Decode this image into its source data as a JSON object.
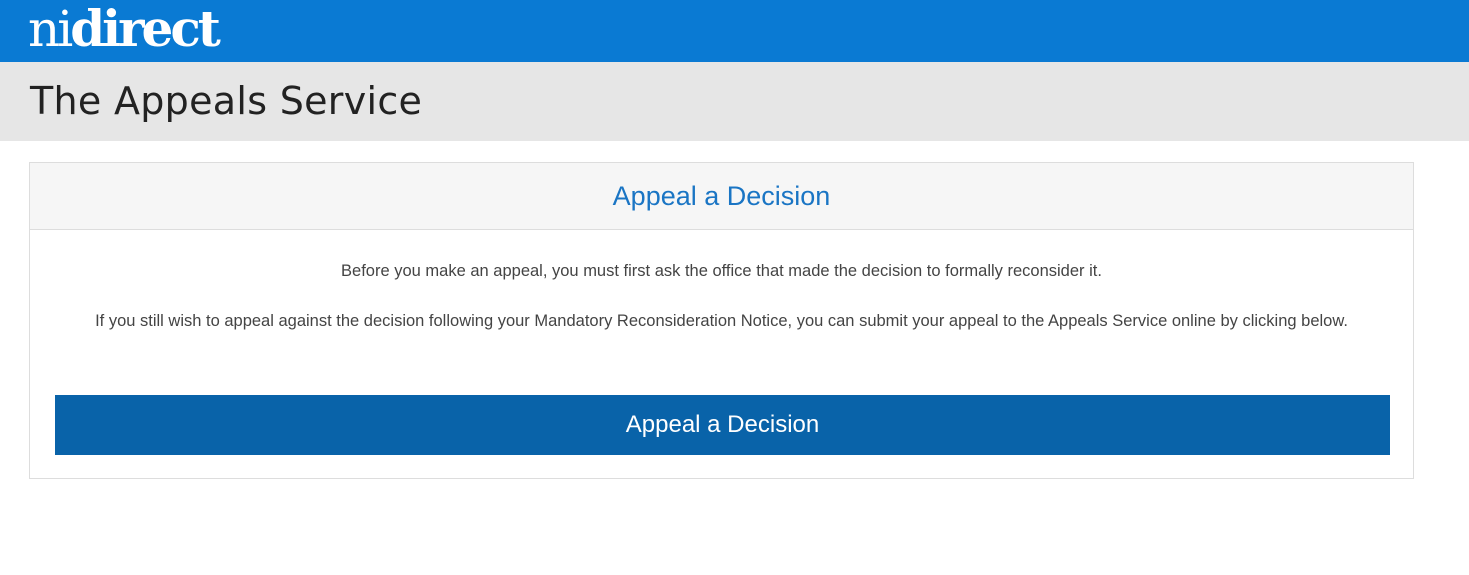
{
  "header": {
    "logo_text_light": "ni",
    "logo_text_bold": "direct",
    "service_title": "The Appeals Service"
  },
  "panel": {
    "heading": "Appeal a Decision",
    "paragraph1": "Before you make an appeal, you must first ask the office that made the decision to formally reconsider it.",
    "paragraph2": "If you still wish to appeal against the decision following your Mandatory Reconsideration Notice, you can submit your appeal to the Appeals Service online by clicking below.",
    "button_label": "Appeal a Decision"
  },
  "colors": {
    "brand_blue": "#0a7ad3",
    "title_bar_grey": "#e6e6e6",
    "button_blue": "#0963a9",
    "heading_blue": "#1a75c4"
  }
}
